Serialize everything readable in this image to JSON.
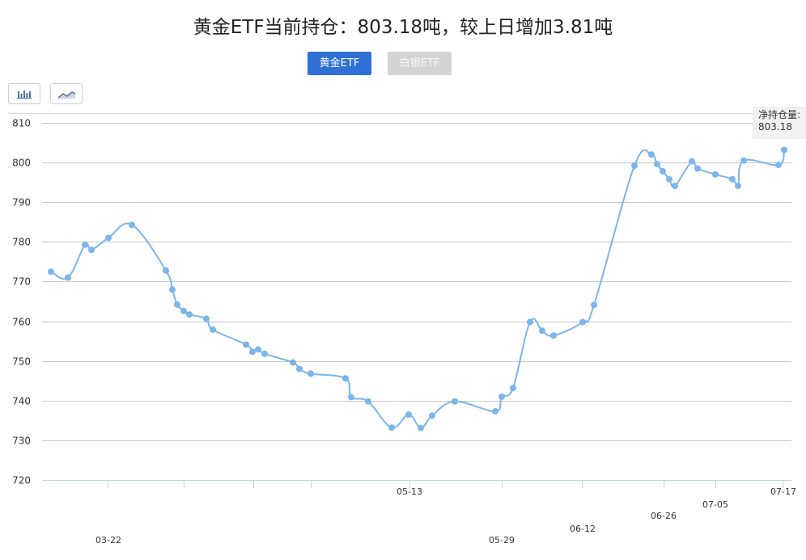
{
  "header": {
    "title": "黄金ETF当前持仓：803.18吨，较上日增加3.81吨"
  },
  "tabs": [
    {
      "label": "黄金ETF",
      "active": true,
      "color": "#2f6fd6"
    },
    {
      "label": "白银ETF",
      "active": false,
      "color": "#d4d4d4"
    }
  ],
  "toolbar": {
    "bar_toggle_icon": "bar-chart-icon",
    "line_toggle_icon": "line-chart-icon"
  },
  "tooltip": {
    "label": "净持仓量:",
    "value": "803.18"
  },
  "chart_data": {
    "type": "line",
    "ylim": [
      720,
      810
    ],
    "yticks": [
      720,
      730,
      740,
      750,
      760,
      770,
      780,
      790,
      800,
      810
    ],
    "grid": true,
    "line_color": "#7cb5ec",
    "x_tick_labels": [
      "03-22",
      "05-13",
      "05-29",
      "06-12",
      "06-26",
      "07-05",
      "07-17"
    ],
    "series": [
      {
        "values": [
          772.5,
          771.0,
          779.3,
          778.0,
          781.0,
          784.3,
          772.8,
          768.0,
          764.2,
          762.6,
          761.7,
          760.6,
          757.9,
          754.1,
          752.3,
          752.9,
          751.8,
          749.6,
          748.0,
          746.8,
          745.6,
          740.9,
          739.8,
          733.2,
          736.5,
          733.1,
          736.2,
          739.8,
          737.3,
          741.0,
          743.2,
          759.8,
          757.6,
          756.4,
          759.8,
          764.1,
          799.2,
          802.0,
          799.6,
          797.8,
          795.8,
          794.1,
          800.3,
          798.5,
          797.0,
          795.8,
          794.1,
          800.5,
          799.4,
          803.18
        ]
      }
    ]
  }
}
